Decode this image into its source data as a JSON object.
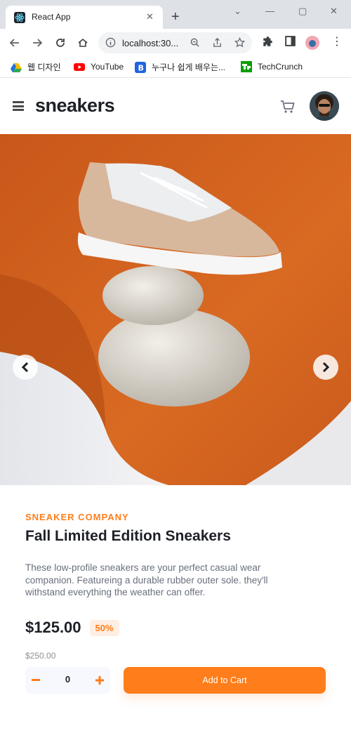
{
  "browser": {
    "tab_title": "React App",
    "url": "localhost:30...",
    "bookmarks": [
      {
        "label": "웹 디자인",
        "icon": "google-drive-icon"
      },
      {
        "label": "YouTube",
        "icon": "youtube-icon"
      },
      {
        "label": "누구나 쉽게 배우는...",
        "icon": "bookmark-b-icon"
      },
      {
        "label": "TechCrunch",
        "icon": "techcrunch-icon"
      }
    ]
  },
  "site": {
    "logo": "sneakers"
  },
  "product": {
    "company": "SNEAKER COMPANY",
    "title": "Fall Limited Edition Sneakers",
    "description": "These low-profile sneakers are your perfect casual wear companion. Featureing a durable rubber outer sole. they'll withstand everything the weather can offer.",
    "price": "$125.00",
    "discount": "50%",
    "old_price": "$250.00",
    "quantity": "0",
    "add_to_cart": "Add to Cart"
  },
  "colors": {
    "accent": "#ff7d1a",
    "accent_pale": "#ffeee2",
    "text_dark": "#1d2026",
    "text_gray": "#68707d"
  }
}
